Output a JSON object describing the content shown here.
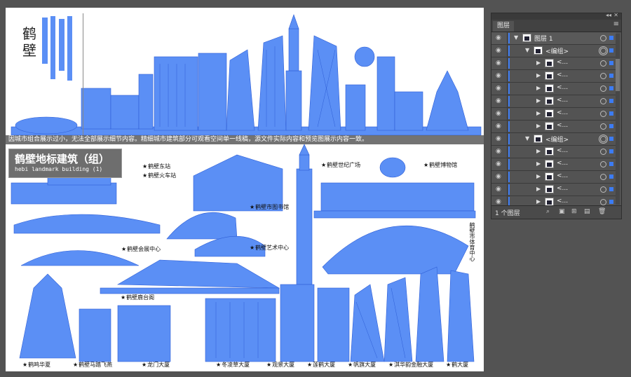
{
  "artboard": {
    "logo_text": "鹤壁",
    "notice": "因城市组合展示过小，无法全部展示细节内容。精细城市建筑部分可观看空间单一线稿，源文件实际内容和预览图展示内容一致。",
    "title_cn": "鹤壁地标建筑（组）",
    "title_en": "hebi landmark building (1)",
    "labels": {
      "east_station": "鹤壁东站",
      "train_station": "鹤壁火车站",
      "library": "鹤壁市图书馆",
      "century_square": "鹤壁世纪广场",
      "museum": "鹤壁博物馆",
      "convention": "鹤壁会展中心",
      "art_center": "鹤壁艺术中心",
      "sports_center": "鹤壁市体育中心",
      "lutai": "鹤壁鹿台阁",
      "hexia": "鹤鸣华夏",
      "horse": "鹤壁马踏飞燕",
      "longmen": "龙门大厦",
      "dongling": "冬凌草大厦",
      "guanjing": "观景大厦",
      "lianhe": "莲鹤大厦",
      "fanqi": "帆旗大厦",
      "financial": "淇华韵金融大厦",
      "hehe": "鹤大厦"
    }
  },
  "layers_panel": {
    "collapse_glyph": "◂◂",
    "close_glyph": "✕",
    "tab_label": "图层",
    "menu_glyph": "≡",
    "rows": [
      {
        "name": "图层 1",
        "level": 0,
        "expanded": true,
        "target_double": false
      },
      {
        "name": "<编组>",
        "level": 1,
        "expanded": true,
        "target_double": true
      },
      {
        "name": "<...",
        "level": 2,
        "expanded": false,
        "target_double": false
      },
      {
        "name": "<...",
        "level": 2,
        "expanded": false,
        "target_double": false
      },
      {
        "name": "<...",
        "level": 2,
        "expanded": false,
        "target_double": false
      },
      {
        "name": "<...",
        "level": 2,
        "expanded": false,
        "target_double": false
      },
      {
        "name": "<...",
        "level": 2,
        "expanded": false,
        "target_double": false
      },
      {
        "name": "<...",
        "level": 2,
        "expanded": false,
        "target_double": false
      },
      {
        "name": "<编组>",
        "level": 1,
        "expanded": true,
        "target_double": true
      },
      {
        "name": "<...",
        "level": 2,
        "expanded": false,
        "target_double": false
      },
      {
        "name": "<...",
        "level": 2,
        "expanded": false,
        "target_double": false
      },
      {
        "name": "<...",
        "level": 2,
        "expanded": false,
        "target_double": false
      },
      {
        "name": "<...",
        "level": 2,
        "expanded": false,
        "target_double": false
      },
      {
        "name": "<...",
        "level": 2,
        "expanded": false,
        "target_double": false
      },
      {
        "name": "<...",
        "level": 2,
        "expanded": false,
        "target_double": false
      }
    ],
    "footer_count": "1 个图层",
    "accent_color": "#3c7cf4"
  }
}
